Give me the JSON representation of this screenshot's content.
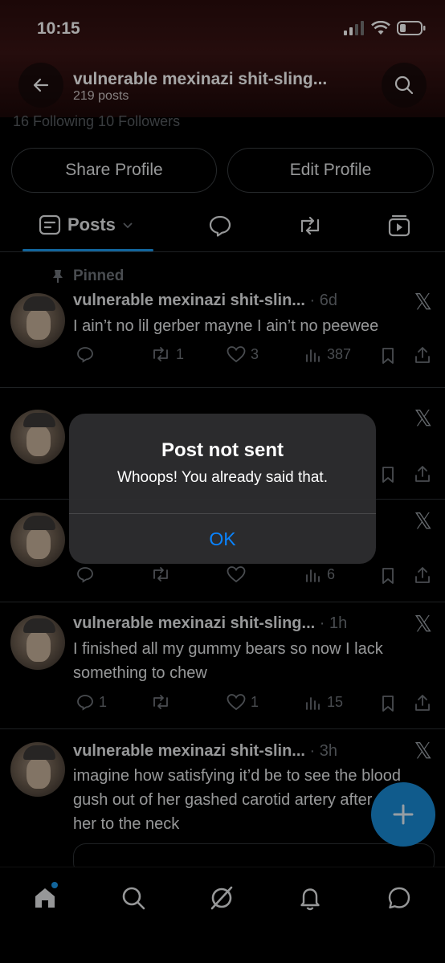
{
  "status": {
    "time": "10:15"
  },
  "header": {
    "title": "vulnerable mexinazi shit-sling...",
    "posts_count": "219 posts"
  },
  "profile": {
    "following_line": "16 Following   10 Followers",
    "share_label": "Share Profile",
    "edit_label": "Edit Profile"
  },
  "tabs": {
    "posts_label": "Posts"
  },
  "posts": [
    {
      "pinned_label": "Pinned",
      "name": "vulnerable mexinazi shit-slin...",
      "time": "· 6d",
      "text": "I ain’t no lil gerber mayne I ain’t no peewee",
      "replies": "",
      "reposts": "1",
      "likes": "3",
      "views": "387"
    },
    {
      "name": "",
      "time": "",
      "text": "",
      "replies": "",
      "reposts": "",
      "likes": "",
      "views": ""
    },
    {
      "name": "",
      "time": "",
      "text": "",
      "replies": "",
      "reposts": "",
      "likes": "",
      "views": "6"
    },
    {
      "name": "vulnerable mexinazi shit-sling...",
      "time": "· 1h",
      "text": "I finished all my gummy bears so now I lack something to chew",
      "replies": "1",
      "reposts": "",
      "likes": "1",
      "views": "15"
    },
    {
      "name": "vulnerable mexinazi shit-slin...",
      "time": "· 3h",
      "text": "imagine how satisfying it’d be to see the blood gush out of her gashed carotid artery after axing her to the neck",
      "replies": "",
      "reposts": "",
      "likes": "",
      "views": ""
    }
  ],
  "alert": {
    "title": "Post not sent",
    "message": "Whoops! You already said that.",
    "ok_label": "OK"
  },
  "colors": {
    "accent": "#1d9bf0",
    "ios_link": "#0a84ff",
    "background": "#000000"
  },
  "icons": [
    "back-arrow-icon",
    "search-icon",
    "pin-icon",
    "x-logo-icon",
    "reply-icon",
    "repost-icon",
    "like-icon",
    "views-icon",
    "bookmark-icon",
    "share-icon",
    "compose-plus-icon",
    "home-icon",
    "grok-icon",
    "bell-icon",
    "messages-icon"
  ]
}
